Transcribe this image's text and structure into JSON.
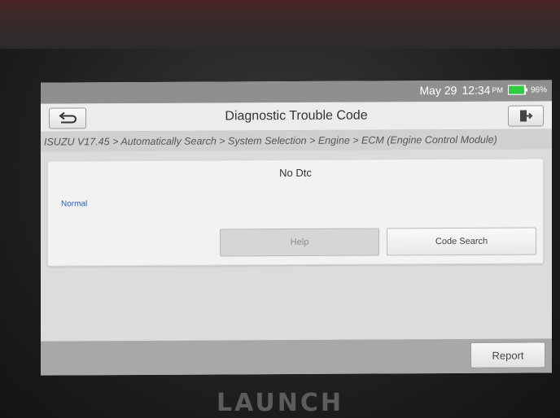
{
  "status": {
    "date": "May 29",
    "time": "12:34",
    "ampm": "PM",
    "battery_percent": "96%",
    "battery_level": 0.96,
    "battery_color": "#2ecc40"
  },
  "header": {
    "title": "Diagnostic Trouble Code",
    "back_icon": "back-arrow-icon",
    "exit_icon": "exit-icon"
  },
  "breadcrumb": "ISUZU V17.45 > Automatically Search > System Selection > Engine > ECM (Engine Control Module)",
  "result": {
    "heading": "No Dtc",
    "status": "Normal",
    "status_color": "#2a5db0"
  },
  "buttons": {
    "help": "Help",
    "code_search": "Code Search",
    "report": "Report"
  },
  "device": {
    "brand": "LAUNCH"
  }
}
